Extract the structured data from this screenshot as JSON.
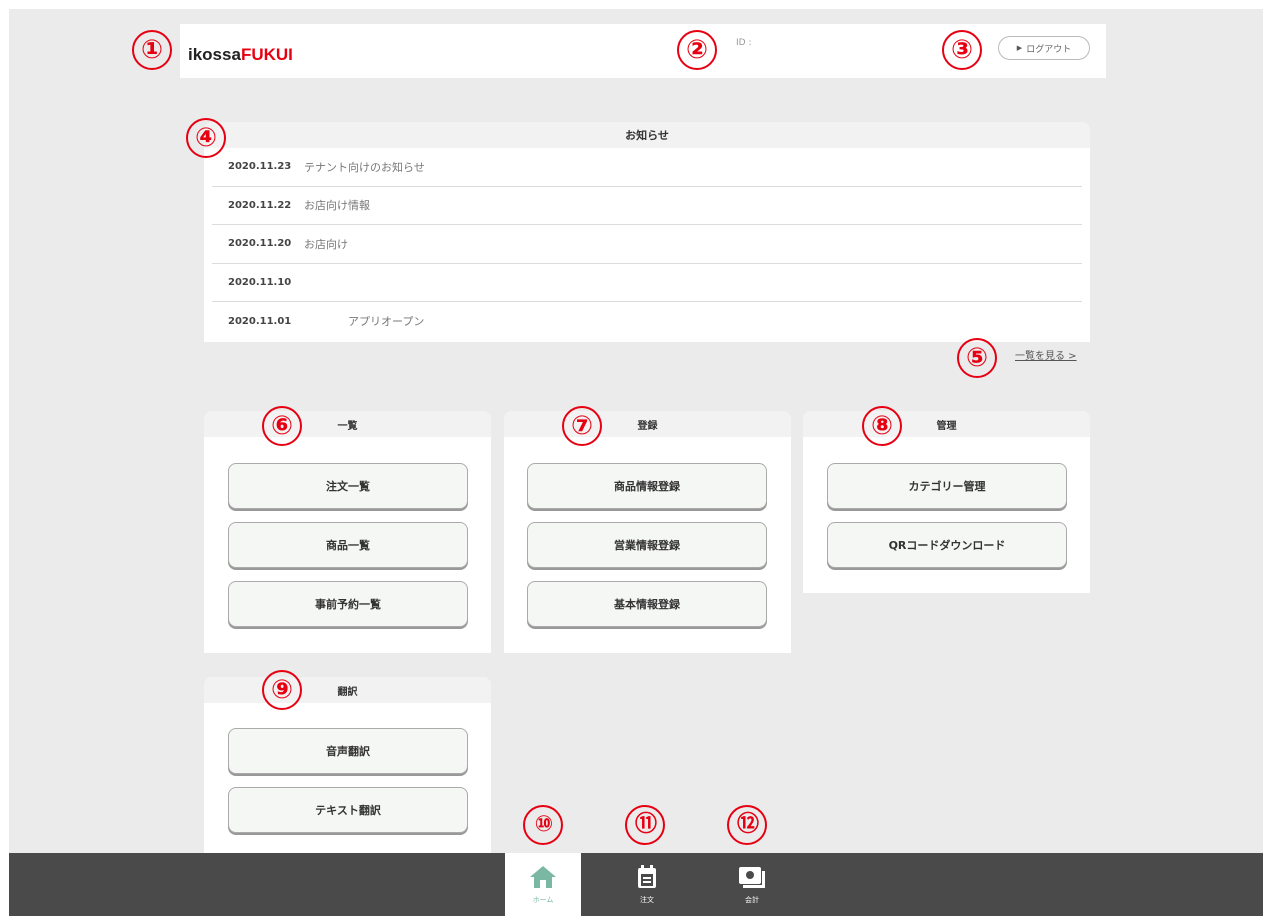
{
  "header": {
    "logo_part1": "ikossa",
    "logo_part2": "FUKUI",
    "id_label": "ID :",
    "logout_label": "ログアウト"
  },
  "markers": [
    "①",
    "②",
    "③",
    "④",
    "⑤",
    "⑥",
    "⑦",
    "⑧",
    "⑨",
    "⑩",
    "⑪",
    "⑫"
  ],
  "news": {
    "title": "お知らせ",
    "items": [
      {
        "date": "2020.11.23",
        "title": "テナント向けのお知らせ"
      },
      {
        "date": "2020.11.22",
        "title": "お店向け情報"
      },
      {
        "date": "2020.11.20",
        "title": "お店向け"
      },
      {
        "date": "2020.11.10",
        "title": ""
      },
      {
        "date": "2020.11.01",
        "title": "アプリオープン"
      }
    ],
    "more_link": "一覧を見る >"
  },
  "panels": {
    "list": {
      "title": "一覧",
      "buttons": [
        "注文一覧",
        "商品一覧",
        "事前予約一覧"
      ]
    },
    "register": {
      "title": "登録",
      "buttons": [
        "商品情報登録",
        "営業情報登録",
        "基本情報登録"
      ]
    },
    "manage": {
      "title": "管理",
      "buttons": [
        "カテゴリー管理",
        "QRコードダウンロード"
      ]
    },
    "translate": {
      "title": "翻訳",
      "buttons": [
        "音声翻訳",
        "テキスト翻訳"
      ]
    }
  },
  "bottom_nav": {
    "home": "ホーム",
    "order": "注文",
    "accounting": "会計"
  },
  "colors": {
    "accent_red": "#e60012",
    "nav_bg": "#4a4a4a",
    "home_active": "#7ab8a4"
  },
  "icons": {
    "home": "home-icon",
    "order": "calendar-icon",
    "accounting": "wallet-icon",
    "logout": "triangle-right-icon"
  }
}
